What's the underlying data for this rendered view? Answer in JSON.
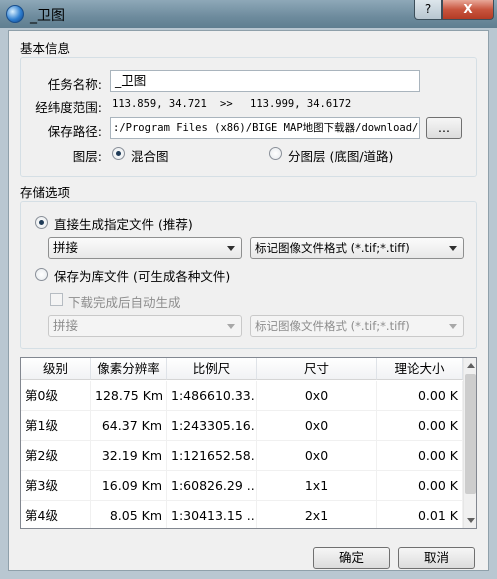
{
  "window": {
    "title": "_卫图",
    "help_glyph": "?",
    "close_glyph": "X"
  },
  "basic": {
    "section_label": "基本信息",
    "task_name_label": "任务名称:",
    "task_name_value": "_卫图",
    "range_label": "经纬度范围:",
    "range_from": "113.859, 34.721",
    "range_arrow": ">>",
    "range_to": "113.999, 34.6172",
    "path_label": "保存路径:",
    "path_value": ":/Program Files (x86)/BIGE MAP地图下载器/download/",
    "browse_label": "...",
    "layer_label": "图层:",
    "layer_option_mixed": "混合图",
    "layer_option_split": "分图层 (底图/道路)"
  },
  "storage": {
    "section_label": "存储选项",
    "option_direct": "直接生成指定文件 (推荐)",
    "direct_mode": "拼接",
    "direct_format": "标记图像文件格式 (*.tif;*.tiff)",
    "option_library": "保存为库文件 (可生成各种文件)",
    "auto_generate": "下载完成后自动生成",
    "library_mode": "拼接",
    "library_format": "标记图像文件格式 (*.tif;*.tiff)"
  },
  "table": {
    "headers": [
      "级别",
      "像素分辨率",
      "比例尺",
      "尺寸",
      "理论大小"
    ],
    "rows": [
      [
        "第0级",
        "128.75 Km",
        "1:486610.33...",
        "0x0",
        "0.00 K"
      ],
      [
        "第1级",
        "64.37 Km",
        "1:243305.16...",
        "0x0",
        "0.00 K"
      ],
      [
        "第2级",
        "32.19 Km",
        "1:121652.58...",
        "0x0",
        "0.00 K"
      ],
      [
        "第3级",
        "16.09 Km",
        "1:60826.29 ...",
        "1x1",
        "0.00 K"
      ],
      [
        "第4级",
        "8.05 Km",
        "1:30413.15 ...",
        "2x1",
        "0.01 K"
      ]
    ]
  },
  "footer": {
    "ok_label": "确定",
    "cancel_label": "取消"
  },
  "colors": {
    "close_button": "#c8553e",
    "titlebar": "#6d8b9d"
  }
}
